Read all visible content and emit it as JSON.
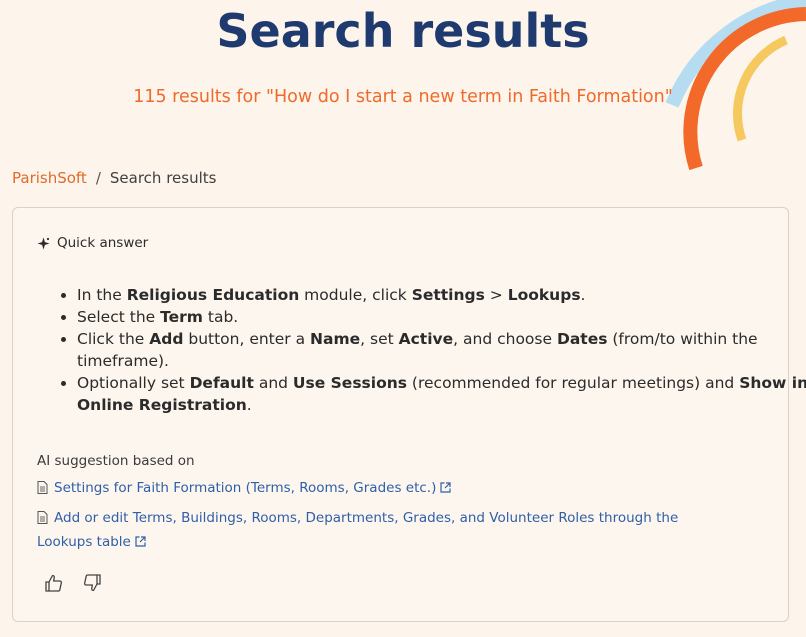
{
  "header": {
    "title": "Search results",
    "results_summary": "115 results for \"How do I start a new term in Faith Formation\""
  },
  "breadcrumb": {
    "home": "ParishSoft",
    "separator": "/",
    "current": "Search results"
  },
  "quick_answer": {
    "label": "Quick answer",
    "steps": [
      {
        "parts": [
          {
            "t": "In the ",
            "b": false
          },
          {
            "t": "Religious Education",
            "b": true
          },
          {
            "t": " module, click ",
            "b": false
          },
          {
            "t": "Settings",
            "b": true
          },
          {
            "t": " > ",
            "b": false
          },
          {
            "t": "Lookups",
            "b": true
          },
          {
            "t": ".",
            "b": false
          }
        ]
      },
      {
        "parts": [
          {
            "t": "Select the ",
            "b": false
          },
          {
            "t": "Term",
            "b": true
          },
          {
            "t": " tab.",
            "b": false
          }
        ]
      },
      {
        "parts": [
          {
            "t": "Click the ",
            "b": false
          },
          {
            "t": "Add",
            "b": true
          },
          {
            "t": " button, enter a ",
            "b": false
          },
          {
            "t": "Name",
            "b": true
          },
          {
            "t": ", set ",
            "b": false
          },
          {
            "t": "Active",
            "b": true
          },
          {
            "t": ", and choose ",
            "b": false
          },
          {
            "t": "Dates",
            "b": true
          },
          {
            "t": " (from/to within the timeframe).",
            "b": false
          }
        ]
      },
      {
        "parts": [
          {
            "t": "Optionally set ",
            "b": false
          },
          {
            "t": "Default",
            "b": true
          },
          {
            "t": " and ",
            "b": false
          },
          {
            "t": "Use Sessions",
            "b": true
          },
          {
            "t": " (recommended for regular meetings) and ",
            "b": false
          },
          {
            "t": "Show in Online Registration",
            "b": true
          },
          {
            "t": ".",
            "b": false
          }
        ]
      }
    ],
    "ai_label": "AI suggestion based on",
    "sources": [
      {
        "title": "Settings for Faith Formation (Terms, Rooms, Grades etc.)"
      },
      {
        "title": "Add or edit Terms, Buildings, Rooms, Departments, Grades, and Volunteer Roles through the Lookups table"
      }
    ]
  },
  "icons": {
    "sparkle": "sparkle-icon",
    "document": "document-icon",
    "external": "external-link-icon",
    "thumbs_up": "thumbs-up-icon",
    "thumbs_down": "thumbs-down-icon"
  },
  "colors": {
    "background": "#fdf5ec",
    "title": "#1f3a6e",
    "accent_orange": "#ef6a2a",
    "link_blue": "#2f5fa8",
    "arc_light_blue": "#b6dcf2",
    "arc_orange": "#f2692a",
    "arc_yellow": "#f5c860"
  }
}
